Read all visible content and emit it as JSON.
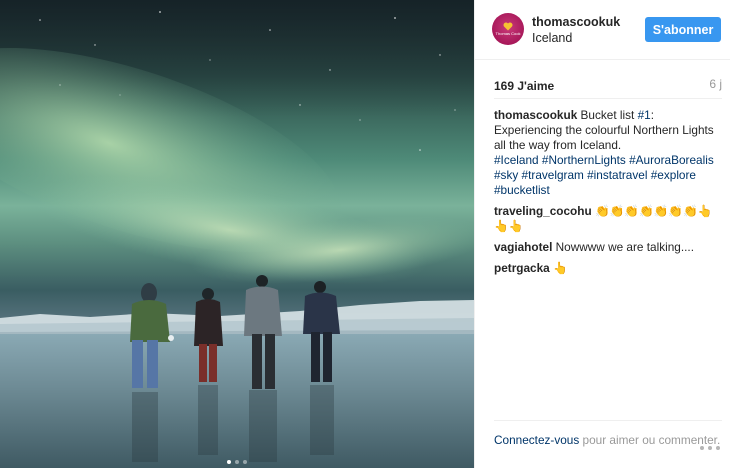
{
  "post": {
    "username": "thomascookuk",
    "location": "Iceland",
    "avatar_text": "Thomas Cook",
    "follow_label": "S'abonner",
    "likes": "169 J'aime",
    "time": "6 j",
    "caption": {
      "user": "thomascookuk",
      "text_a": "Bucket list ",
      "tag_num": "#1",
      "text_b": ": Experiencing the colourful Northern Lights all the way from Iceland.",
      "hashtags": [
        "#Iceland",
        "#NorthernLights",
        "#AuroraBorealis",
        "#sky",
        "#travelgram",
        "#instatravel",
        "#explore",
        "#bucketlist"
      ]
    },
    "comments": [
      {
        "user": "traveling_cocohu",
        "text": "👏👏👏👏👏👏👏👆👆👆"
      },
      {
        "user": "vagiahotel",
        "text": "Nowwww we are talking...."
      },
      {
        "user": "petrgacka",
        "text": "👆"
      }
    ],
    "footer": {
      "login_link": "Connectez-vous",
      "prompt": "pour aimer ou commenter."
    },
    "carousel": {
      "count": 3,
      "active_index": 0
    }
  },
  "colors": {
    "follow_button": "#3897f0",
    "link": "#003569",
    "meta_text": "#999999",
    "avatar_brand": "#a8185a"
  },
  "icons": {
    "more": "ellipsis-icon",
    "logo": "heart-logo-icon"
  }
}
